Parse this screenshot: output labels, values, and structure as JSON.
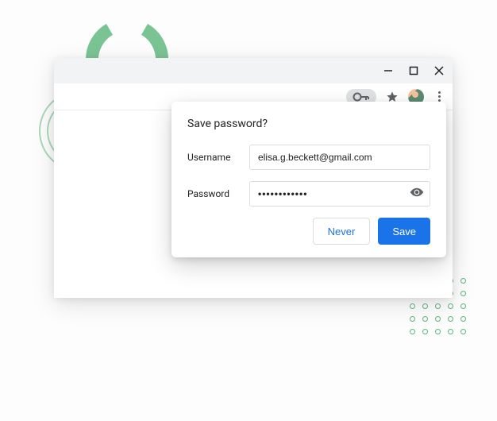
{
  "popup": {
    "title": "Save password?",
    "username_label": "Username",
    "password_label": "Password",
    "username_value": "elisa.g.beckett@gmail.com",
    "password_value": "••••••••••••",
    "never_label": "Never",
    "save_label": "Save"
  },
  "colors": {
    "accent_blue": "#1a73e8",
    "decorative_green": "#5cb67e"
  }
}
